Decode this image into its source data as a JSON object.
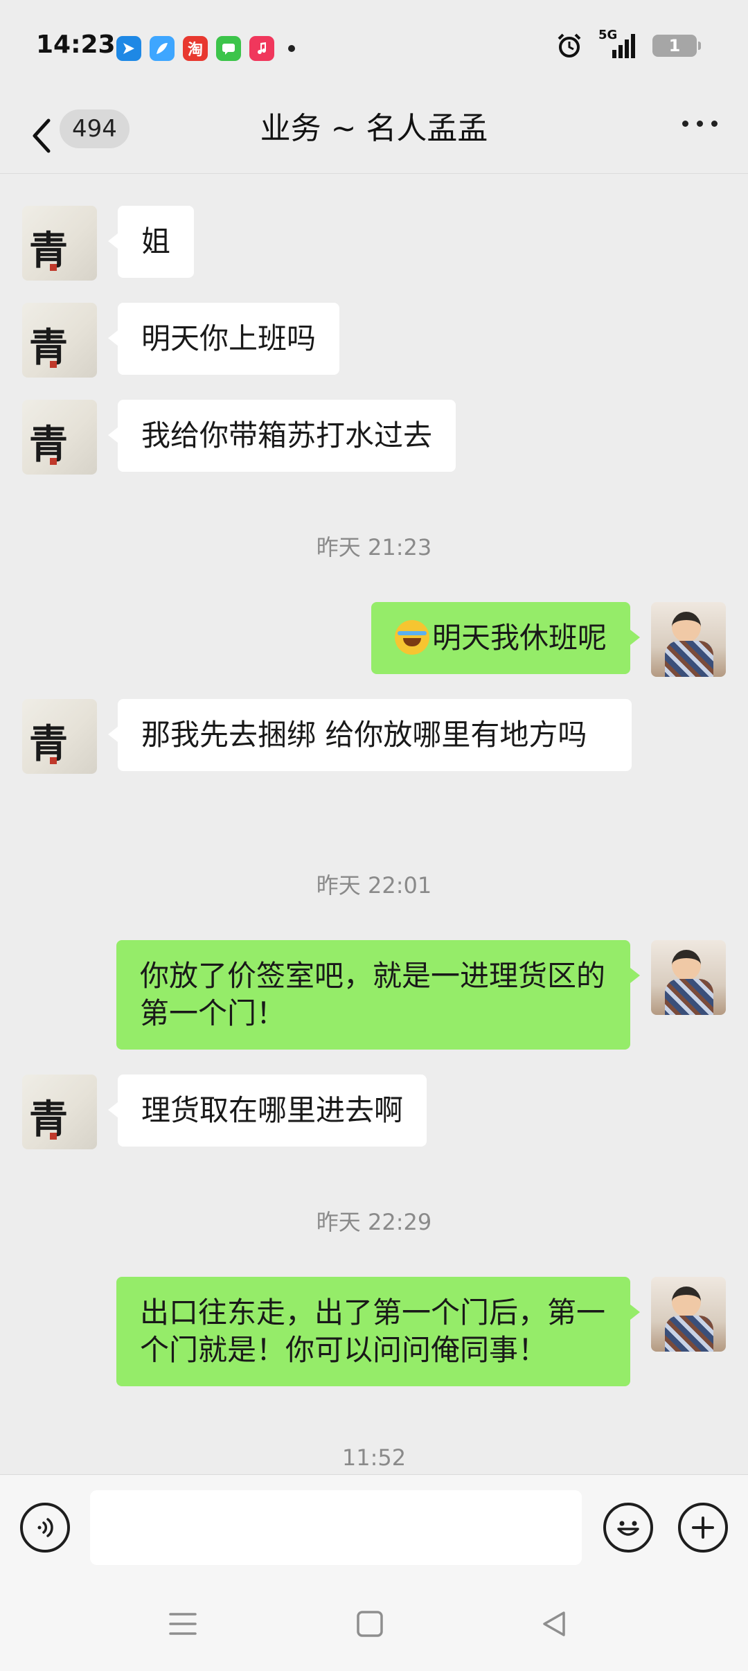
{
  "status_bar": {
    "time": "14:23",
    "app_icons": [
      "bluebird-app-icon",
      "feather-app-icon",
      "taobao-app-icon",
      "messages-app-icon",
      "music-app-icon"
    ],
    "taobao_glyph": "淘",
    "network": "5G",
    "battery": "1"
  },
  "header": {
    "back_label": "<",
    "unread_count": "494",
    "title": "业务 ~ 名人孟孟"
  },
  "messages": [
    {
      "side": "left",
      "text": "姐"
    },
    {
      "side": "left",
      "text": "明天你上班吗"
    },
    {
      "side": "left",
      "text": "我给你带箱苏打水过去"
    },
    {
      "time": "昨天 21:23"
    },
    {
      "side": "right",
      "emoji": "laughing-crying-emoji",
      "text": "明天我休班呢"
    },
    {
      "side": "left",
      "text": "那我先去捆绑  给你放哪里有地方吗"
    },
    {
      "time": "昨天 22:01"
    },
    {
      "side": "right",
      "text": "你放了价签室吧，就是一进理货区的第一个门！"
    },
    {
      "side": "left",
      "text": "理货取在哪里进去啊"
    },
    {
      "time": "昨天 22:29"
    },
    {
      "side": "right",
      "text": "出口往东走，出了第一个门后，第一个门就是！你可以问问俺同事！"
    },
    {
      "time": "11:52"
    }
  ],
  "input_bar": {
    "voice_icon": "voice-icon",
    "input_value": "",
    "emoji_icon": "emoji-icon",
    "plus_icon": "plus-icon"
  },
  "colors": {
    "background": "#ededed",
    "outgoing_bubble": "#95ec69",
    "incoming_bubble": "#ffffff",
    "timestamp": "#8a8a8a"
  }
}
